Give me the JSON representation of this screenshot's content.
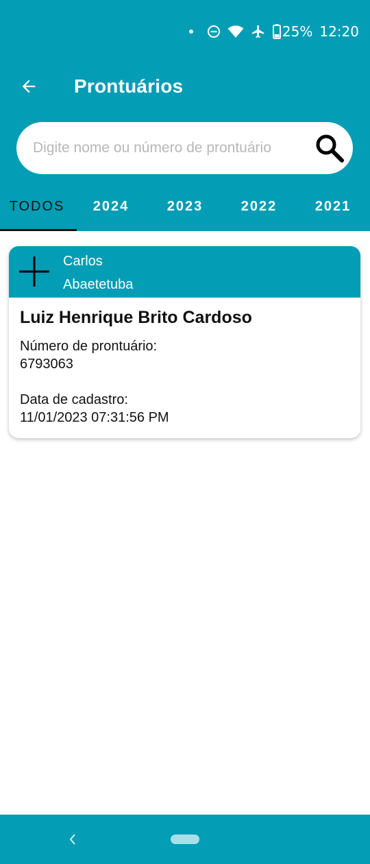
{
  "status_bar": {
    "battery": "25%",
    "time": "12:20",
    "icons": [
      "notification-dot",
      "do-not-disturb-icon",
      "wifi-icon",
      "airplane-icon",
      "battery-icon"
    ]
  },
  "header": {
    "title": "Prontuários",
    "back_icon": "arrow-left-icon"
  },
  "search": {
    "placeholder": "Digite nome ou número de prontuário",
    "value": "",
    "icon": "search-icon"
  },
  "tabs": [
    {
      "label": "TODOS",
      "active": true
    },
    {
      "label": "2024",
      "active": false
    },
    {
      "label": "2023",
      "active": false
    },
    {
      "label": "2022",
      "active": false
    },
    {
      "label": "2021",
      "active": false
    }
  ],
  "records": [
    {
      "header_line1": "Carlos",
      "header_line2": "Abaetetuba",
      "name": "Luiz Henrique Brito Cardoso",
      "number_label": "Número de prontuário:",
      "number_value": "6793063",
      "date_label": "Data de cadastro:",
      "date_value": "11/01/2023 07:31:56 PM"
    }
  ],
  "colors": {
    "primary": "#039db5",
    "text": "#111111",
    "background": "#ffffff",
    "home_pill": "#a8dfe8"
  }
}
